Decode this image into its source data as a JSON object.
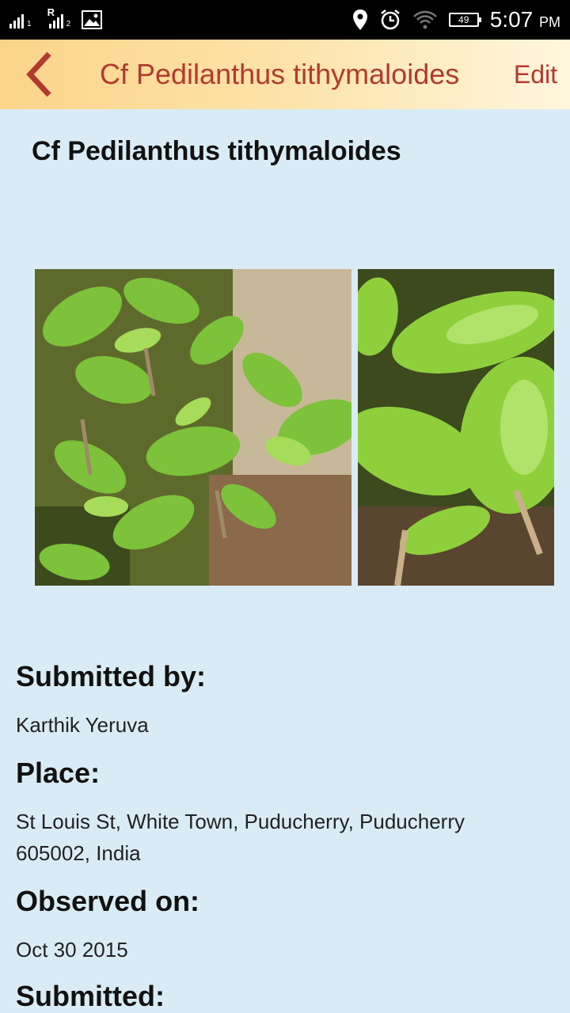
{
  "status_bar": {
    "sim1": "1",
    "sim2": "2",
    "roaming": "R",
    "battery": "49",
    "time": "5:07",
    "ampm": "PM"
  },
  "app_bar": {
    "title": "Cf Pedilanthus tithymaloides",
    "edit_label": "Edit",
    "accent": "#b23a2f"
  },
  "observation": {
    "species": "Cf Pedilanthus tithymaloides",
    "photos": [
      "leafy-shrub-photo",
      "close-leaf-photo"
    ],
    "submitted_by_label": "Submitted by:",
    "submitted_by": "Karthik Yeruva",
    "place_label": "Place:",
    "place": "St Louis St, White Town, Puducherry, Puducherry 605002, India",
    "observed_on_label": "Observed on:",
    "observed_on": "Oct 30 2015",
    "submitted_label": "Submitted:"
  }
}
